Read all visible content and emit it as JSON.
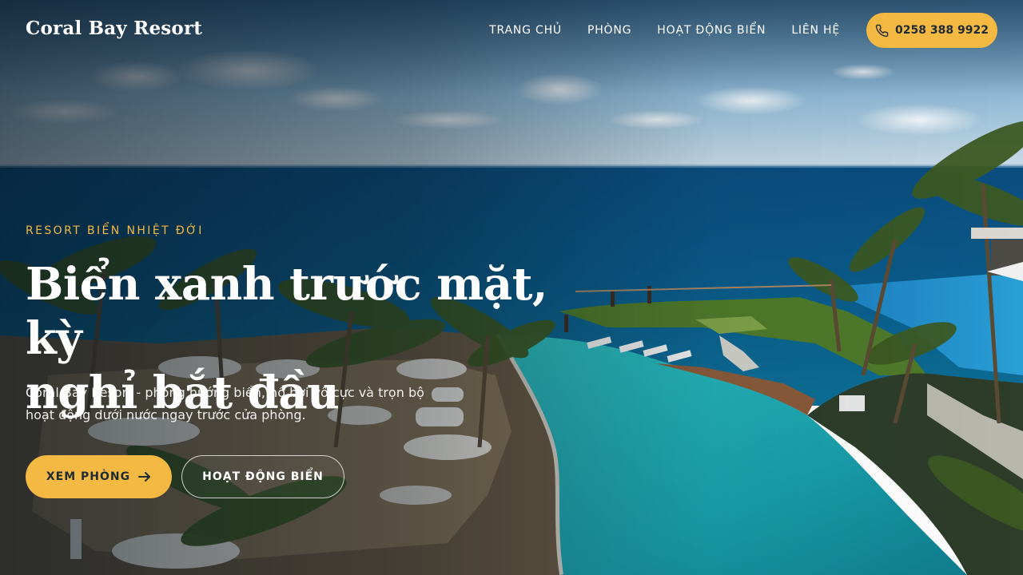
{
  "header": {
    "logo": "Coral Bay Resort",
    "nav": [
      {
        "label": "TRANG CHỦ"
      },
      {
        "label": "PHÒNG"
      },
      {
        "label": "HOẠT ĐỘNG BIỂN"
      },
      {
        "label": "LIÊN HỆ"
      }
    ],
    "phone": "0258 388 9922",
    "phone_icon": "phone-icon"
  },
  "hero": {
    "eyebrow": "RESORT BIỂN NHIỆT ĐỚI",
    "headline_line1": "Biển xanh trước mặt, kỳ",
    "headline_line2": "nghỉ bắt đầu",
    "subtext": "Coral Bay Resort - phòng hướng biển, hồ bơi vô cực và trọn bộ hoạt động dưới nước ngay trước cửa phòng.",
    "primary_button": "XEM PHÒNG",
    "primary_button_icon": "arrow-right-icon",
    "secondary_button": "HOẠT ĐỘNG BIỂN"
  },
  "colors": {
    "accent": "#f4b942",
    "dark_text": "#1f2b33",
    "sea": "#0e4f7a",
    "pool": "#2bb3b8"
  }
}
